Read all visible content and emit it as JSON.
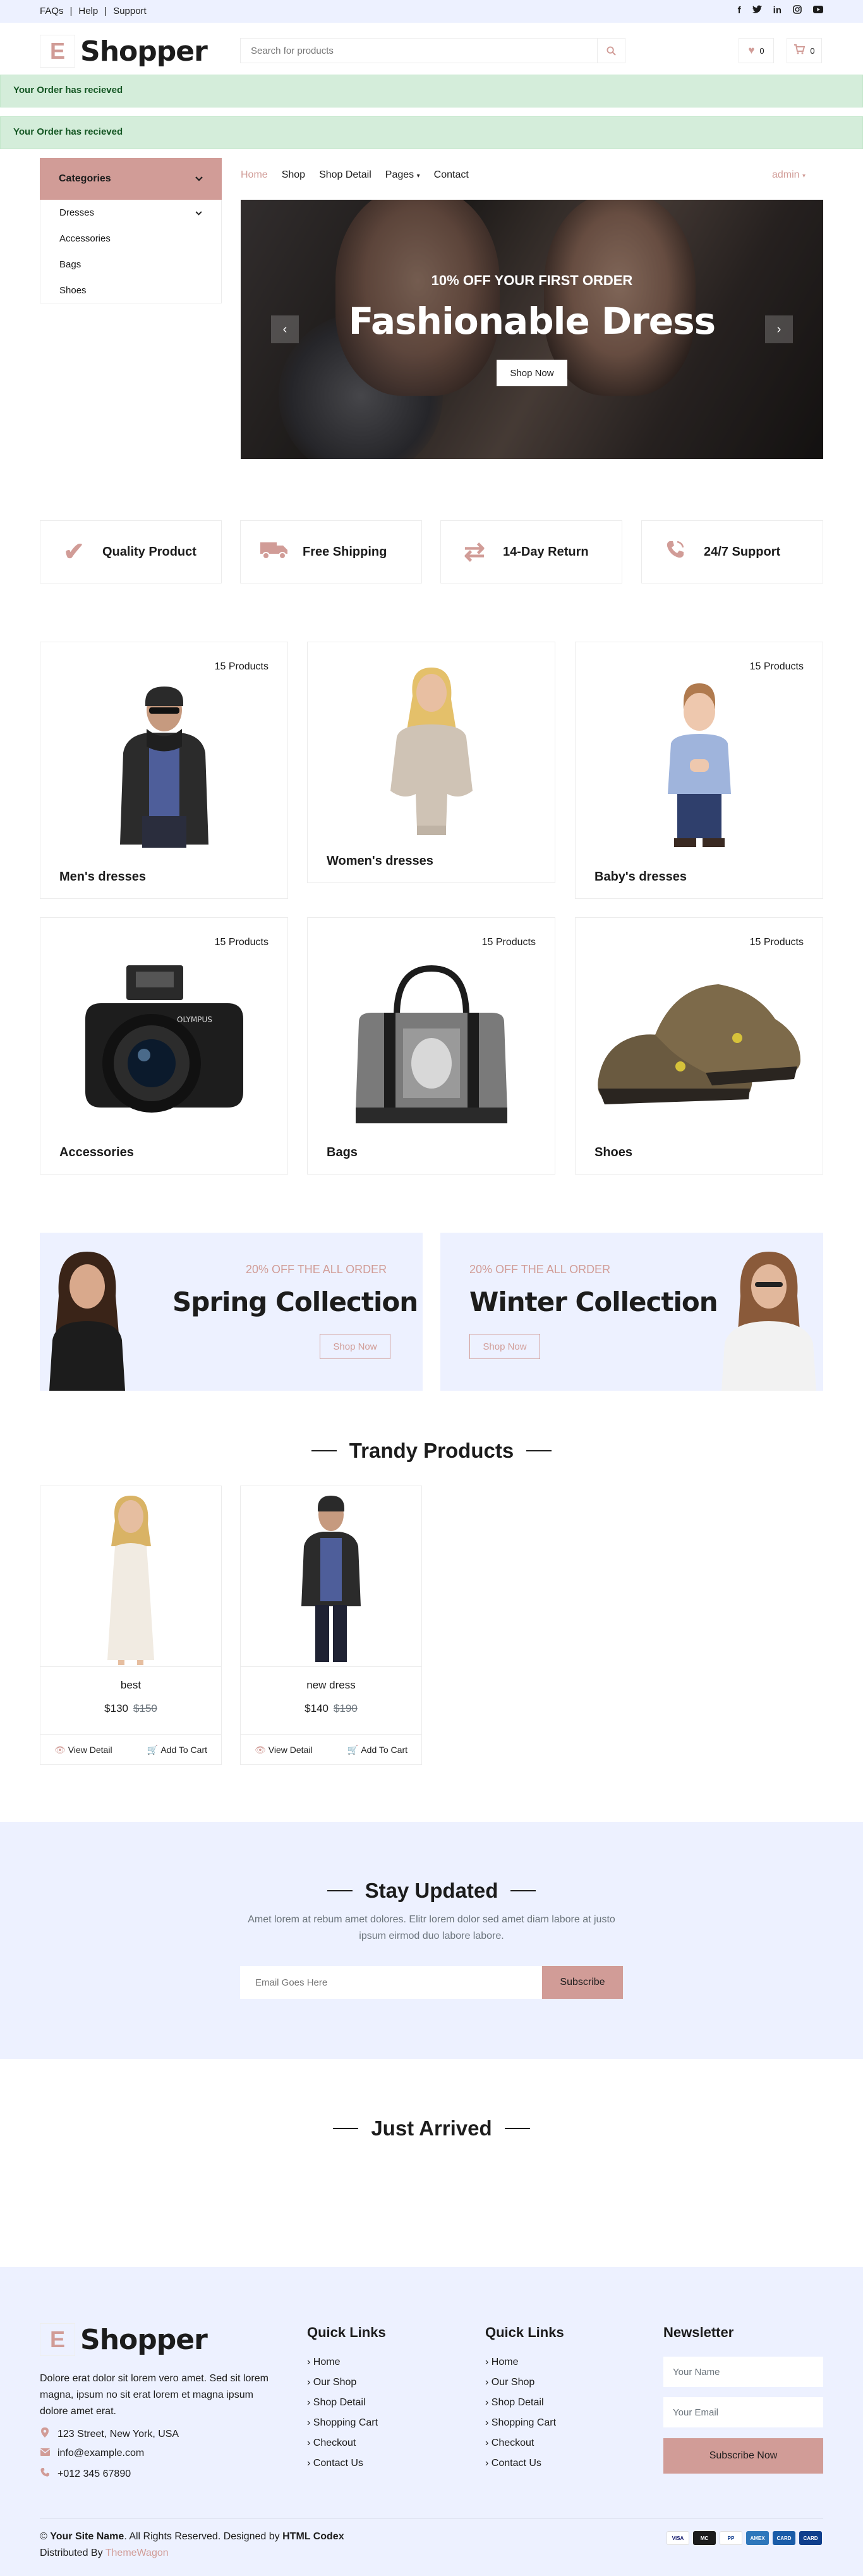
{
  "topbar": {
    "links": [
      "FAQs",
      "Help",
      "Support"
    ],
    "separator": "|",
    "social_icons": [
      "facebook-icon",
      "twitter-icon",
      "linkedin-icon",
      "instagram-icon",
      "youtube-icon"
    ]
  },
  "header": {
    "logo_letter": "E",
    "logo_text": "Shopper",
    "search_placeholder": "Search for products",
    "wishlist_count": "0",
    "cart_count": "0"
  },
  "alerts": [
    "Your Order has recieved",
    "Your Order has recieved"
  ],
  "categories": {
    "title": "Categories",
    "items": [
      "Dresses",
      "Accessories",
      "Bags",
      "Shoes"
    ]
  },
  "nav": {
    "items": [
      "Home",
      "Shop",
      "Shop Detail",
      "Pages",
      "Contact"
    ],
    "active": "Home",
    "user": "admin"
  },
  "carousel": {
    "subtitle": "10% OFF YOUR FIRST ORDER",
    "title": "Fashionable Dress",
    "button": "Shop Now"
  },
  "features": [
    "Quality Product",
    "Free Shipping",
    "14-Day Return",
    "24/7 Support"
  ],
  "category_cards": [
    {
      "name": "Men's dresses",
      "count": "15 Products"
    },
    {
      "name": "Women's dresses",
      "count": ""
    },
    {
      "name": "Baby's dresses",
      "count": "15 Products"
    },
    {
      "name": "Accessories",
      "count": "15 Products"
    },
    {
      "name": "Bags",
      "count": "15 Products"
    },
    {
      "name": "Shoes",
      "count": "15 Products"
    }
  ],
  "offers": [
    {
      "tag": "20% OFF THE ALL ORDER",
      "title": "Spring Collection",
      "button": "Shop Now"
    },
    {
      "tag": "20% OFF THE ALL ORDER",
      "title": "Winter Collection",
      "button": "Shop Now"
    }
  ],
  "trendy": {
    "title": "Trandy Products",
    "products": [
      {
        "name": "best",
        "price": "$130",
        "old_price": "$150",
        "view": "View Detail",
        "cart": "Add To Cart"
      },
      {
        "name": "new dress",
        "price": "$140",
        "old_price": "$190",
        "view": "View Detail",
        "cart": "Add To Cart"
      }
    ]
  },
  "newsletter": {
    "title": "Stay Updated",
    "text": "Amet lorem at rebum amet dolores. Elitr lorem dolor sed amet diam labore at justo ipsum eirmod duo labore labore.",
    "placeholder": "Email Goes Here",
    "button": "Subscribe"
  },
  "just_arrived": {
    "title": "Just Arrived"
  },
  "footer": {
    "logo_letter": "E",
    "logo_text": "Shopper",
    "about": "Dolore erat dolor sit lorem vero amet. Sed sit lorem magna, ipsum no sit erat lorem et magna ipsum dolore amet erat.",
    "address": "123 Street, New York, USA",
    "email": "info@example.com",
    "phone": "+012 345 67890",
    "col1_title": "Quick Links",
    "col2_title": "Quick Links",
    "links": [
      "Home",
      "Our Shop",
      "Shop Detail",
      "Shopping Cart",
      "Checkout",
      "Contact Us"
    ],
    "news_title": "Newsletter",
    "name_placeholder": "Your Name",
    "email_placeholder": "Your Email",
    "subscribe": "Subscribe Now",
    "copy_site": "Your Site Name",
    "copy_text": ". All Rights Reserved. Designed by ",
    "copy_designer": "HTML Codex",
    "distributed_label": "Distributed By ",
    "distributed_by": "ThemeWagon",
    "payments": [
      "VISA",
      "MC",
      "PP",
      "AMEX",
      "CARD",
      "CARD"
    ]
  },
  "colors": {
    "accent": "#d19c97",
    "light": "#edf1ff",
    "success_bg": "#d4edda",
    "success_text": "#155724"
  }
}
